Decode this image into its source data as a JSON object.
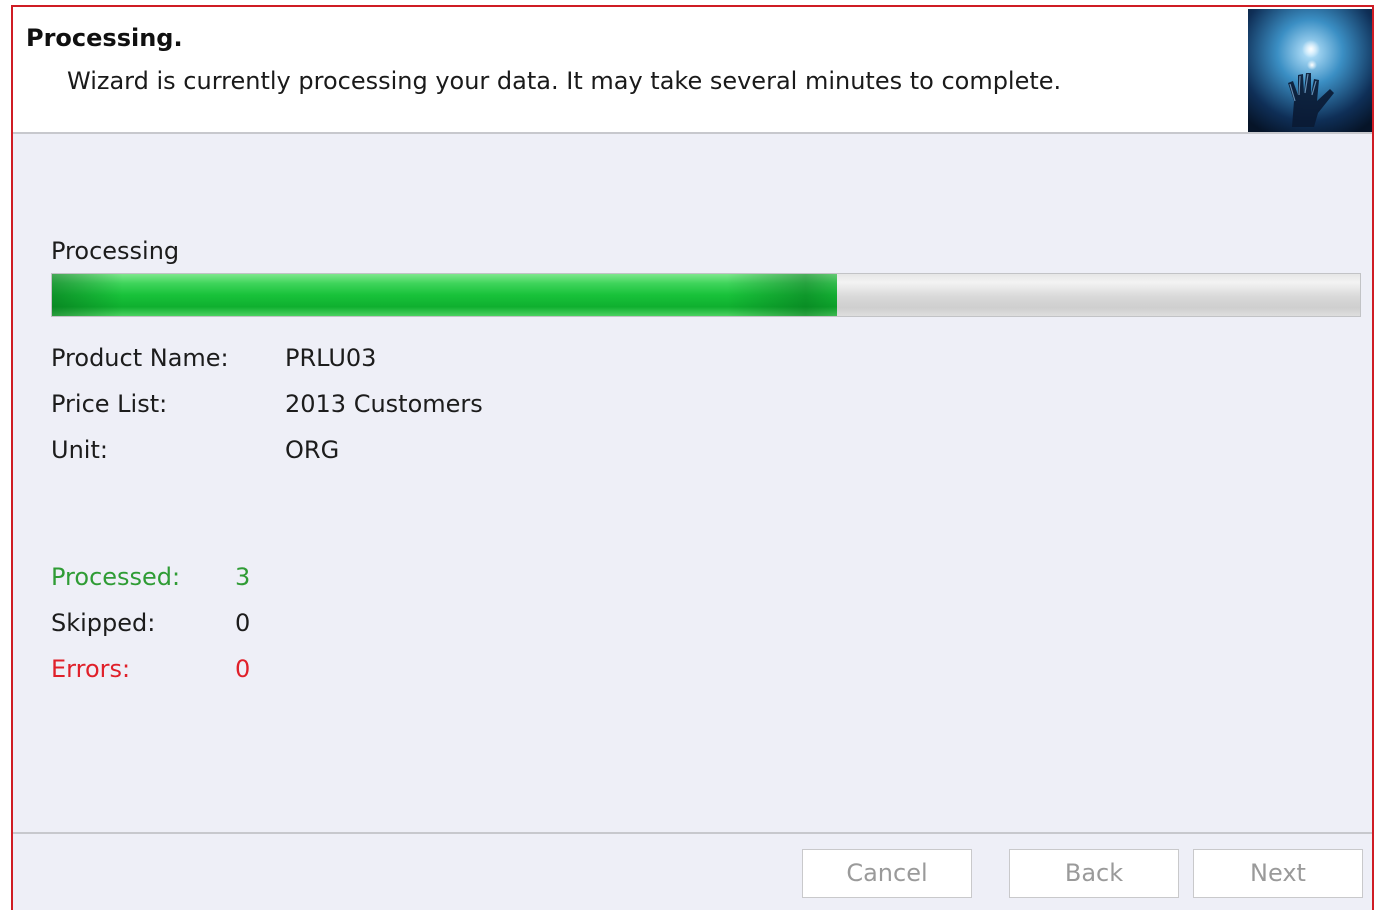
{
  "header": {
    "title": "Processing.",
    "subtitle": "Wizard is currently processing your data. It may take several minutes to complete.",
    "image_icon": "glowing-hand-icon"
  },
  "progress": {
    "label": "Processing",
    "fraction": 0.6
  },
  "details": [
    {
      "label": "Product Name:",
      "value": "PRLU03"
    },
    {
      "label": "Price List:",
      "value": "2013 Customers"
    },
    {
      "label": "Unit:",
      "value": "ORG"
    }
  ],
  "stats": {
    "processed": {
      "label": "Processed:",
      "value": "3",
      "color": "#2f9c35"
    },
    "skipped": {
      "label": "Skipped:",
      "value": "0",
      "color": "#1c1c1c"
    },
    "errors": {
      "label": "Errors:",
      "value": "0",
      "color": "#e0202a"
    }
  },
  "buttons": {
    "cancel": "Cancel",
    "back": "Back",
    "next": "Next"
  },
  "colors": {
    "frame_border": "#cf1c24",
    "panel_background": "#eeeff7",
    "progress_fill": "#18c23a"
  }
}
